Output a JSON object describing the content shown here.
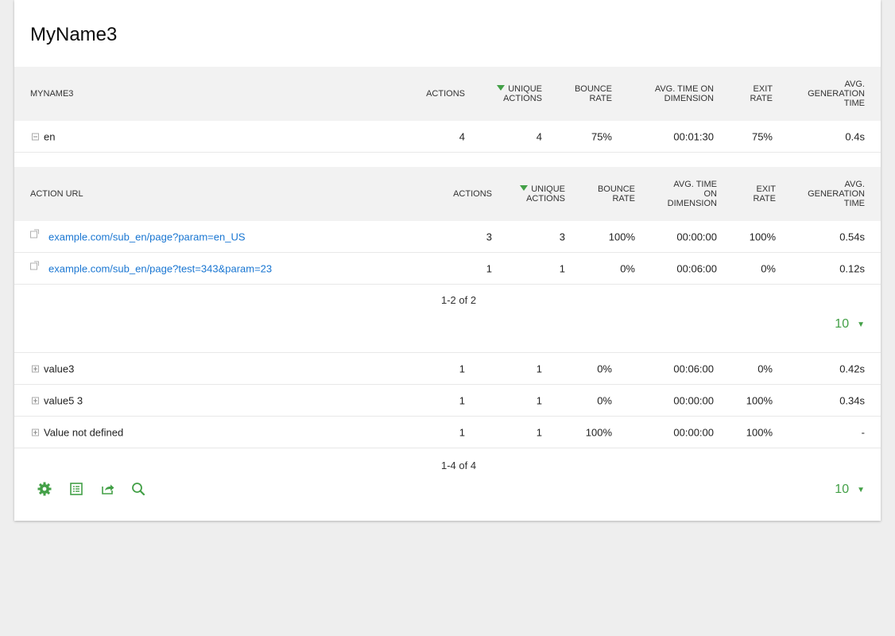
{
  "title": "MyName3",
  "main_header": {
    "label": "MYNAME3",
    "actions": "ACTIONS",
    "unique_actions": "UNIQUE ACTIONS",
    "bounce_rate": "BOUNCE RATE",
    "avg_time": "AVG. TIME ON DIMENSION",
    "exit_rate": "EXIT RATE",
    "gen_time": "AVG. GENERATION TIME"
  },
  "rows": [
    {
      "label": "en",
      "actions": "4",
      "unique": "4",
      "bounce": "75%",
      "time": "00:01:30",
      "exit": "75%",
      "gen": "0.4s"
    },
    {
      "label": "value3",
      "actions": "1",
      "unique": "1",
      "bounce": "0%",
      "time": "00:06:00",
      "exit": "0%",
      "gen": "0.42s"
    },
    {
      "label": "value5 3",
      "actions": "1",
      "unique": "1",
      "bounce": "0%",
      "time": "00:00:00",
      "exit": "100%",
      "gen": "0.34s"
    },
    {
      "label": "Value not defined",
      "actions": "1",
      "unique": "1",
      "bounce": "100%",
      "time": "00:00:00",
      "exit": "100%",
      "gen": "-"
    }
  ],
  "sub_header": {
    "label": "ACTION URL",
    "actions": "ACTIONS",
    "unique_actions": "UNIQUE ACTIONS",
    "bounce_rate": "BOUNCE RATE",
    "avg_time": "AVG. TIME ON DIMENSION",
    "exit_rate": "EXIT RATE",
    "gen_time": "AVG. GENERATION TIME"
  },
  "sub_rows": [
    {
      "url": "example.com/sub_en/page?param=en_US",
      "actions": "3",
      "unique": "3",
      "bounce": "100%",
      "time": "00:00:00",
      "exit": "100%",
      "gen": "0.54s"
    },
    {
      "url": "example.com/sub_en/page?test=343&param=23",
      "actions": "1",
      "unique": "1",
      "bounce": "0%",
      "time": "00:06:00",
      "exit": "0%",
      "gen": "0.12s"
    }
  ],
  "sub_pagination": "1-2 of 2",
  "sub_limit": "10",
  "main_pagination": "1-4 of 4",
  "main_limit": "10",
  "footer_icons": [
    "gear-icon",
    "table-icon",
    "export-icon",
    "search-icon"
  ],
  "colors": {
    "accent": "#43a047",
    "link": "#1976d2",
    "header_bg": "#f2f2f2"
  }
}
